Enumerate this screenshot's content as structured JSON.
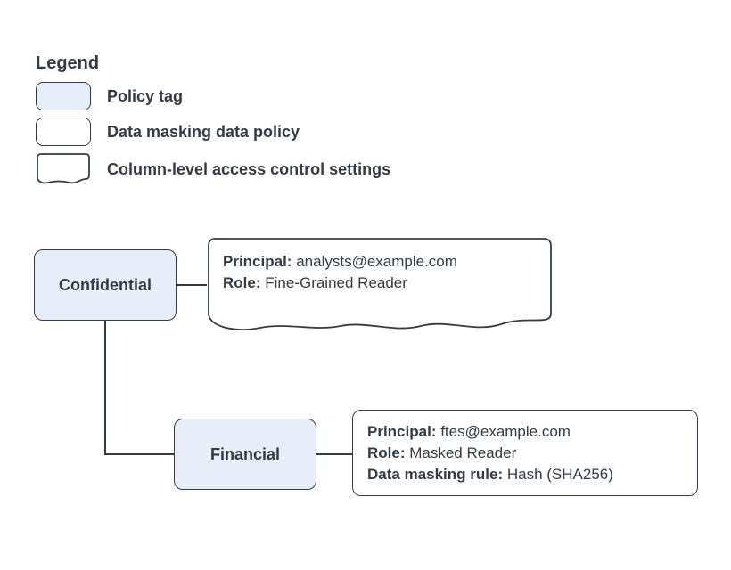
{
  "legend": {
    "title": "Legend",
    "items": [
      {
        "label": "Policy tag"
      },
      {
        "label": "Data masking data policy"
      },
      {
        "label": "Column-level access control settings"
      }
    ]
  },
  "diagram": {
    "tags": {
      "confidential": {
        "label": "Confidential"
      },
      "financial": {
        "label": "Financial"
      }
    },
    "clacs_confidential": {
      "principal_label": "Principal:",
      "principal_value": "analysts@example.com",
      "role_label": "Role:",
      "role_value": "Fine-Grained Reader"
    },
    "mask_financial": {
      "principal_label": "Principal:",
      "principal_value": "ftes@example.com",
      "role_label": "Role:",
      "role_value": "Masked Reader",
      "rule_label": "Data masking rule:",
      "rule_value": "Hash (SHA256)"
    }
  },
  "colors": {
    "stroke": "#333b45",
    "policy_fill": "#e7eef9"
  }
}
